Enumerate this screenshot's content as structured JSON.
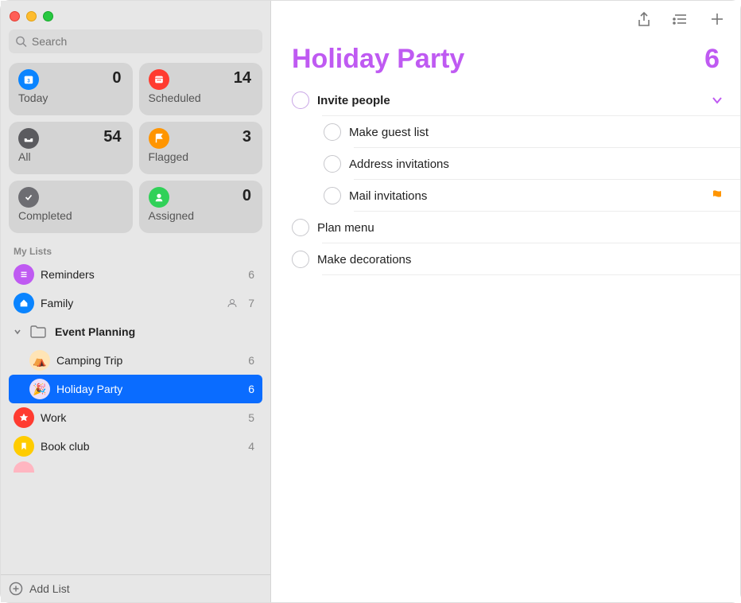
{
  "search": {
    "placeholder": "Search"
  },
  "smart_lists": [
    {
      "id": "today",
      "label": "Today",
      "count": 0,
      "icon": "calendar"
    },
    {
      "id": "scheduled",
      "label": "Scheduled",
      "count": 14,
      "icon": "calendar-lines"
    },
    {
      "id": "all",
      "label": "All",
      "count": 54,
      "icon": "tray"
    },
    {
      "id": "flagged",
      "label": "Flagged",
      "count": 3,
      "icon": "flag"
    },
    {
      "id": "completed",
      "label": "Completed",
      "count": "",
      "icon": "check"
    },
    {
      "id": "assigned",
      "label": "Assigned",
      "count": 0,
      "icon": "person"
    }
  ],
  "section_label": "My Lists",
  "lists": {
    "reminders": {
      "name": "Reminders",
      "count": 6
    },
    "family": {
      "name": "Family",
      "count": 7
    },
    "group": {
      "name": "Event Planning"
    },
    "camping": {
      "name": "Camping Trip",
      "count": 6
    },
    "holiday": {
      "name": "Holiday Party",
      "count": 6
    },
    "work": {
      "name": "Work",
      "count": 5
    },
    "bookclub": {
      "name": "Book club",
      "count": 4
    }
  },
  "add_list_label": "Add List",
  "main": {
    "title": "Holiday Party",
    "count": 6,
    "accent": "#bf5af2",
    "reminders": [
      {
        "title": "Invite people",
        "parent": true,
        "expanded": true
      },
      {
        "title": "Make guest list",
        "sub": true
      },
      {
        "title": "Address invitations",
        "sub": true
      },
      {
        "title": "Mail invitations",
        "sub": true,
        "flagged": true
      },
      {
        "title": "Plan menu"
      },
      {
        "title": "Make decorations"
      }
    ]
  }
}
